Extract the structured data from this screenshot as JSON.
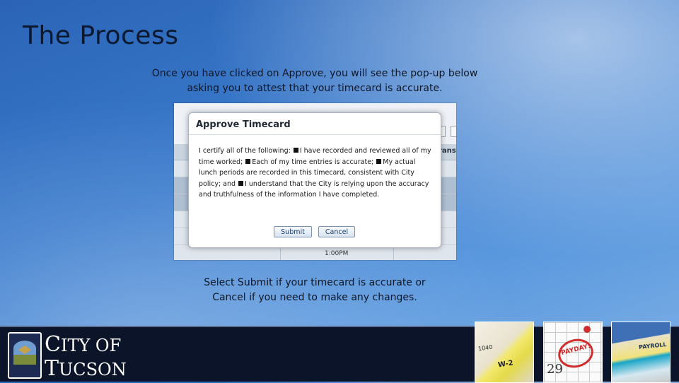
{
  "slide": {
    "title": "The Process",
    "intro_line1": "Once you have clicked on Approve, you will see the pop-up below",
    "intro_line2": "asking you to attest that your timecard is accurate.",
    "outro_line1": "Select Submit if your timecard is accurate or",
    "outro_line2": "Cancel if you need to make any changes."
  },
  "screenshot": {
    "background": {
      "header_fragment": "ransf",
      "time_value": "1:00PM"
    },
    "dialog": {
      "title": "Approve Timecard",
      "text_1": "I certify all of the following:",
      "text_2": "I have recorded and reviewed all of my time worked;",
      "text_3": "Each of my time entries is accurate;",
      "text_4": "My actual lunch periods are recorded in this timecard, consistent with City policy; and",
      "text_5": "I understand that the City is relying upon the accuracy and truthfulness of the information I have completed.",
      "submit_label": "Submit",
      "cancel_label": "Cancel"
    }
  },
  "footer": {
    "brand_line1_big": "C",
    "brand_line1_rest": "ITY OF",
    "brand_line2_big": "T",
    "brand_line2_rest": "UCSON",
    "photo_1_tag": "1040",
    "photo_1_text": "W-2",
    "photo_2_stamp": "PAYDAY!",
    "photo_2_day": "29",
    "photo_3_tag": "PAYROLL"
  },
  "colors": {
    "background_top": "#2b64b6",
    "footer": "#0b1428",
    "stamp_red": "#d12c2c"
  }
}
